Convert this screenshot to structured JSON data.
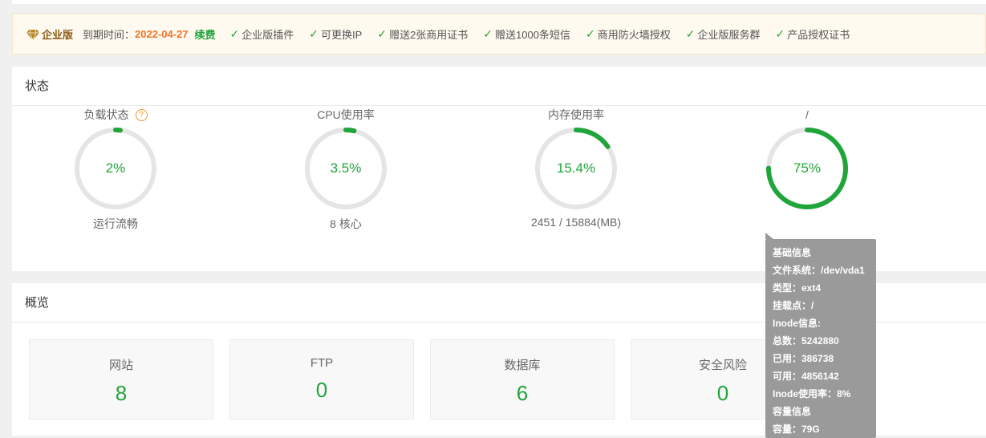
{
  "vip": {
    "badge": "企业版",
    "expire_label": "到期时间：",
    "expire_date": "2022-04-27",
    "renew": "续费",
    "perks": [
      "企业版插件",
      "可更换IP",
      "赠送2张商用证书",
      "赠送1000条短信",
      "商用防火墙授权",
      "企业版服务群",
      "产品授权证书"
    ]
  },
  "status": {
    "title": "状态",
    "gauges": [
      {
        "title": "负载状态",
        "has_help": true,
        "help_icon": "?",
        "percent_text": "2%",
        "value": 2,
        "subtitle": "运行流畅"
      },
      {
        "title": "CPU使用率",
        "has_help": false,
        "percent_text": "3.5%",
        "value": 3.5,
        "subtitle": "8 核心"
      },
      {
        "title": "内存使用率",
        "has_help": false,
        "percent_text": "15.4%",
        "value": 15.4,
        "subtitle": "2451 / 15884(MB)"
      },
      {
        "title": "/",
        "has_help": false,
        "percent_text": "75%",
        "value": 75,
        "subtitle": ""
      }
    ]
  },
  "overview": {
    "title": "概览",
    "cards": [
      {
        "label": "网站",
        "value": "8"
      },
      {
        "label": "FTP",
        "value": "0"
      },
      {
        "label": "数据库",
        "value": "6"
      },
      {
        "label": "安全风险",
        "value": "0"
      }
    ]
  },
  "tooltip": {
    "lines": [
      "基础信息",
      "文件系统：/dev/vda1",
      "类型：ext4",
      "挂载点：/",
      "Inode信息:",
      "总数：5242880",
      "已用：386738",
      "可用：4856142",
      "Inode使用率：8%",
      "容量信息",
      "容量：79G"
    ]
  },
  "colors": {
    "accent": "#20a53a",
    "warning": "#f0732b",
    "ring_track": "#e5e5e5"
  }
}
